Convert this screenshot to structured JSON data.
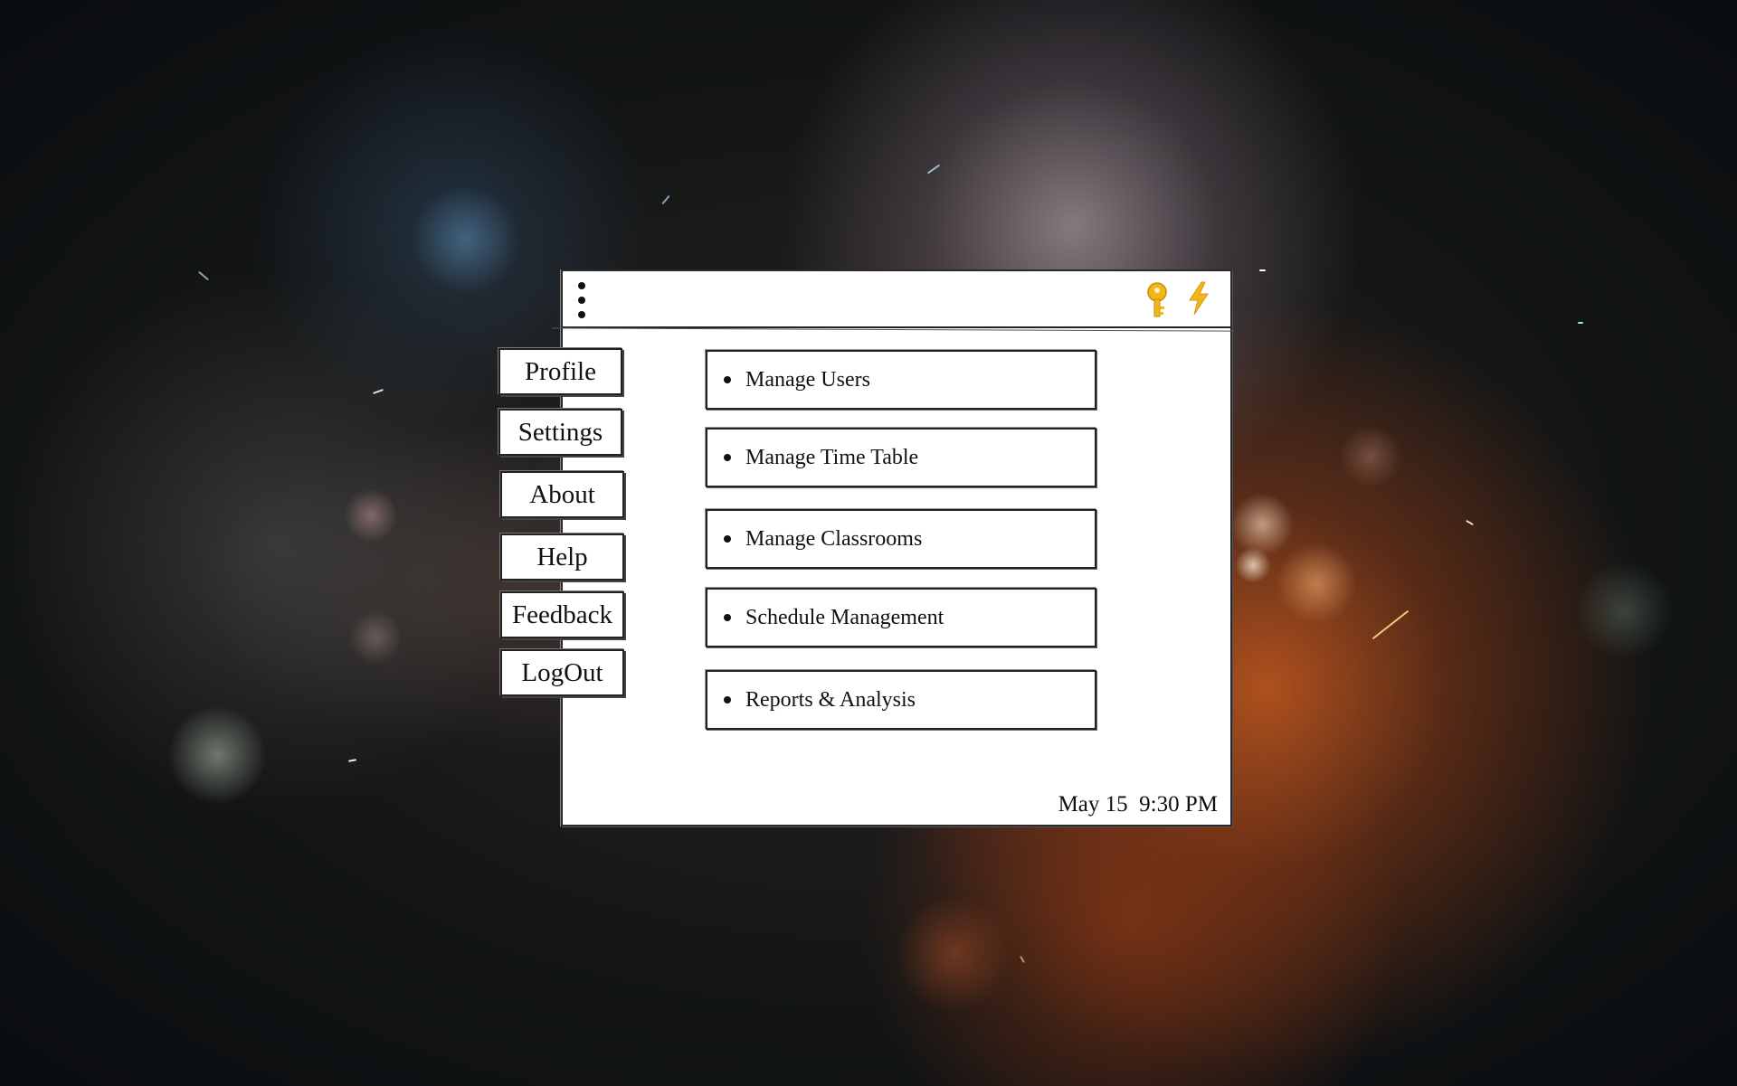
{
  "window": {
    "menu_icon": "kebab-menu-icon",
    "icons": [
      "key-icon",
      "lightning-bolt-icon"
    ],
    "accent_color": "#f3b51c"
  },
  "sidebar": {
    "items": [
      {
        "label": "Profile"
      },
      {
        "label": "Settings"
      },
      {
        "label": "About"
      },
      {
        "label": "Help"
      },
      {
        "label": "Feedback"
      },
      {
        "label": "LogOut"
      }
    ]
  },
  "main": {
    "items": [
      {
        "label": "Manage Users"
      },
      {
        "label": "Manage Time Table"
      },
      {
        "label": "Manage Classrooms"
      },
      {
        "label": "Schedule Management"
      },
      {
        "label": "Reports & Analysis"
      }
    ]
  },
  "status": {
    "date": "May 15",
    "time": "9:30 PM"
  }
}
